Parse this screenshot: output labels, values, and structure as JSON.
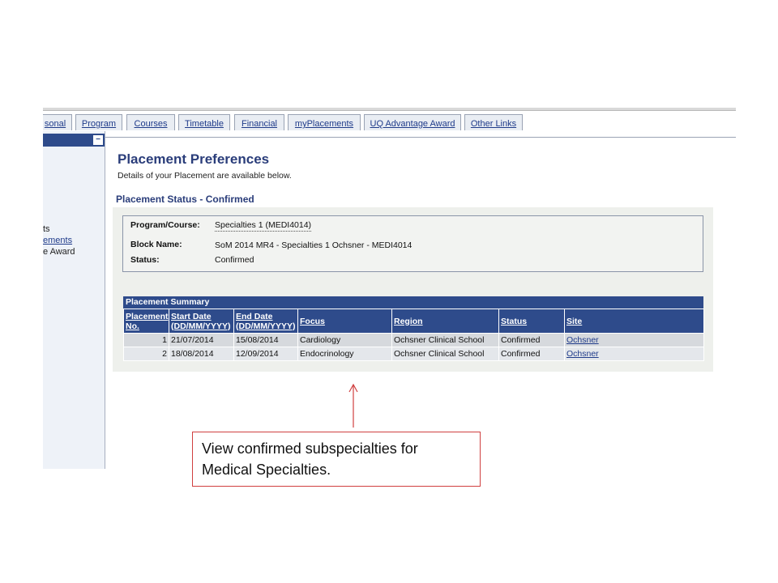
{
  "tabs": [
    {
      "label": "sonal"
    },
    {
      "label": "Program"
    },
    {
      "label": "Courses"
    },
    {
      "label": "Timetable"
    },
    {
      "label": "Financial"
    },
    {
      "label": "myPlacements"
    },
    {
      "label": "UQ Advantage Award"
    },
    {
      "label": "Other Links"
    }
  ],
  "sidebar": {
    "collapse_label": "−",
    "items": [
      {
        "label": "ts"
      },
      {
        "label": "ements"
      },
      {
        "label": "e Award"
      }
    ]
  },
  "page": {
    "title": "Placement Preferences",
    "subtitle": "Details of your Placement are available below.",
    "status_heading": "Placement Status - Confirmed"
  },
  "details": {
    "program_label": "Program/Course:",
    "program_value": "Specialties 1 (MEDI4014)",
    "block_label": "Block Name:",
    "block_value": "SoM 2014 MR4 - Specialties 1 Ochsner - MEDI4014",
    "status_label": "Status:",
    "status_value": "Confirmed"
  },
  "summary": {
    "title": "Placement Summary",
    "columns": [
      {
        "line1": "Placement",
        "line2": "No."
      },
      {
        "line1": "Start Date",
        "line2": "(DD/MM/YYYY)"
      },
      {
        "line1": "End Date",
        "line2": "(DD/MM/YYYY)"
      },
      {
        "line1": "Focus",
        "line2": ""
      },
      {
        "line1": "Region",
        "line2": ""
      },
      {
        "line1": "Status",
        "line2": ""
      },
      {
        "line1": "Site",
        "line2": ""
      }
    ],
    "rows": [
      {
        "no": "1",
        "start": "21/07/2014",
        "end": "15/08/2014",
        "focus": "Cardiology",
        "region": "Ochsner Clinical School",
        "status": "Confirmed",
        "site": "Ochsner"
      },
      {
        "no": "2",
        "start": "18/08/2014",
        "end": "12/09/2014",
        "focus": "Endocrinology",
        "region": "Ochsner Clinical School",
        "status": "Confirmed",
        "site": "Ochsner"
      }
    ]
  },
  "callout": {
    "line1": "View confirmed subspecialties for",
    "line2": "Medical Specialties."
  },
  "colors": {
    "header_blue": "#2e4b8b",
    "title_blue": "#2a3d7a",
    "link_blue": "#1f3b8a",
    "callout_border": "#d04040"
  }
}
